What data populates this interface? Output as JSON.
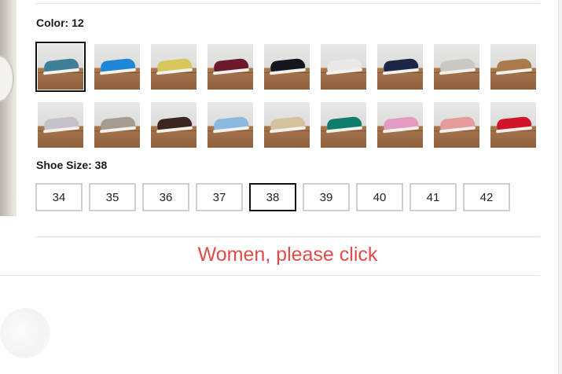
{
  "product_options": {
    "color": {
      "label": "Color: 12",
      "swatches": [
        {
          "name": "teal",
          "shoe_color": "#3f7f99",
          "selected": true
        },
        {
          "name": "bright-blue",
          "shoe_color": "#1f86d8",
          "selected": false
        },
        {
          "name": "yellow",
          "shoe_color": "#d7c75a",
          "selected": false
        },
        {
          "name": "burgundy",
          "shoe_color": "#6a1a2a",
          "selected": false
        },
        {
          "name": "black",
          "shoe_color": "#14161d",
          "selected": false
        },
        {
          "name": "white",
          "shoe_color": "#e9e8e5",
          "selected": false
        },
        {
          "name": "navy",
          "shoe_color": "#1c2748",
          "selected": false
        },
        {
          "name": "light-grey",
          "shoe_color": "#c9c7c2",
          "selected": false
        },
        {
          "name": "tan",
          "shoe_color": "#a97a4b",
          "selected": false
        },
        {
          "name": "lilac-grey",
          "shoe_color": "#c6c0c8",
          "selected": false
        },
        {
          "name": "taupe",
          "shoe_color": "#a59c91",
          "selected": false
        },
        {
          "name": "dark-brown",
          "shoe_color": "#3a2721",
          "selected": false
        },
        {
          "name": "sky-blue",
          "shoe_color": "#8cbadf",
          "selected": false
        },
        {
          "name": "beige",
          "shoe_color": "#d2c29f",
          "selected": false
        },
        {
          "name": "emerald",
          "shoe_color": "#0f7d6a",
          "selected": false
        },
        {
          "name": "pink",
          "shoe_color": "#e49ac0",
          "selected": false
        },
        {
          "name": "salmon-pink",
          "shoe_color": "#e59a9b",
          "selected": false
        },
        {
          "name": "red",
          "shoe_color": "#d0152b",
          "selected": false
        }
      ]
    },
    "size": {
      "label": "Shoe Size: 38",
      "options": [
        "34",
        "35",
        "36",
        "37",
        "38",
        "39",
        "40",
        "41",
        "42"
      ],
      "selected": "38"
    }
  },
  "women_link": {
    "label": "Women, please click",
    "color": "#e04b4b"
  }
}
